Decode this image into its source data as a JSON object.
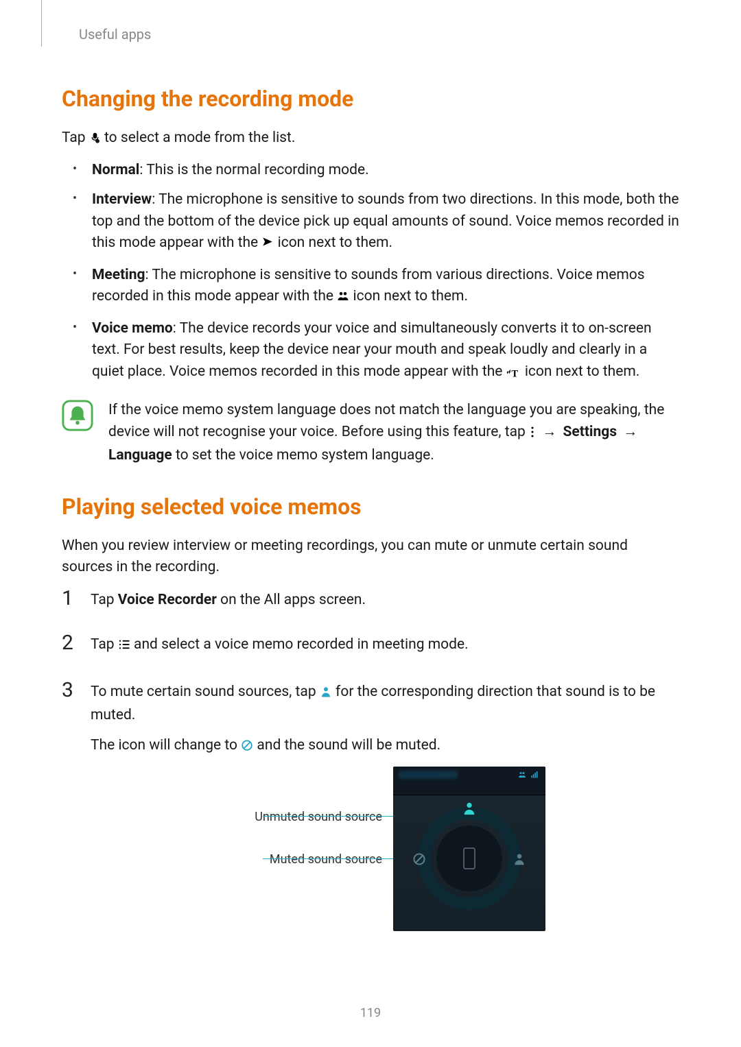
{
  "header": {
    "text": "Useful apps"
  },
  "section1": {
    "heading": "Changing the recording mode",
    "intro_pre": "Tap ",
    "intro_post": " to select a mode from the list.",
    "bullets": {
      "normal_label": "Normal",
      "normal_text": ": This is the normal recording mode.",
      "interview_label": "Interview",
      "interview_text_pre": ": The microphone is sensitive to sounds from two directions. In this mode, both the top and the bottom of the device pick up equal amounts of sound. Voice memos recorded in this mode appear with the ",
      "interview_text_post": " icon next to them.",
      "meeting_label": "Meeting",
      "meeting_text_pre": ": The microphone is sensitive to sounds from various directions. Voice memos recorded in this mode appear with the ",
      "meeting_text_post": " icon next to them.",
      "voicememo_label": "Voice memo",
      "voicememo_text_pre": ": The device records your voice and simultaneously converts it to on-screen text. For best results, keep the device near your mouth and speak loudly and clearly in a quiet place. Voice memos recorded in this mode appear with the ",
      "voicememo_text_post": " icon next to them."
    },
    "note_pre": "If the voice memo system language does not match the language you are speaking, the device will not recognise your voice. Before using this feature, tap ",
    "note_arrow": " → ",
    "note_settings": "Settings",
    "note_arrow2": " → ",
    "note_language": "Language",
    "note_post": " to set the voice memo system language."
  },
  "section2": {
    "heading": "Playing selected voice memos",
    "intro": "When you review interview or meeting recordings, you can mute or unmute certain sound sources in the recording.",
    "steps": {
      "n1": "1",
      "n2": "2",
      "n3": "3",
      "s1_pre": "Tap ",
      "s1_bold": "Voice Recorder",
      "s1_post": " on the All apps screen.",
      "s2_pre": "Tap ",
      "s2_post": " and select a voice memo recorded in meeting mode.",
      "s3_pre": "To mute certain sound sources, tap ",
      "s3_post": " for the corresponding direction that sound is to be muted.",
      "s3_line2_pre": "The icon will change to ",
      "s3_line2_post": " and the sound will be muted."
    },
    "callouts": {
      "unmuted": "Unmuted sound source",
      "muted": "Muted sound source"
    }
  },
  "pagenum": "119"
}
